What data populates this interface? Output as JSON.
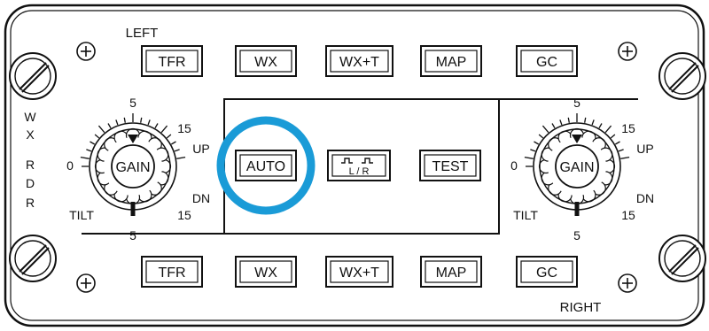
{
  "labels": {
    "left": "LEFT",
    "right": "RIGHT",
    "wx_rdr": [
      "W",
      "X",
      "R",
      "D",
      "R"
    ]
  },
  "top_row": [
    "TFR",
    "WX",
    "WX+T",
    "MAP",
    "GC"
  ],
  "bottom_row": [
    "TFR",
    "WX",
    "WX+T",
    "MAP",
    "GC"
  ],
  "center_buttons": {
    "auto": "AUTO",
    "lr": "L / R",
    "test": "TEST"
  },
  "left_knob": {
    "center": "GAIN",
    "tilt": "TILT",
    "up": "UP",
    "dn": "DN",
    "scale": {
      "top": "5",
      "upper": "15",
      "zero": "0",
      "lower": "15",
      "bottom": "5"
    }
  },
  "right_knob": {
    "center": "GAIN",
    "tilt": "TILT",
    "up": "UP",
    "dn": "DN",
    "scale": {
      "top": "5",
      "upper": "15",
      "zero": "0",
      "lower": "15",
      "bottom": "5"
    }
  },
  "colors": {
    "highlight": "#1a9bd7",
    "ink": "#111111",
    "panel": "#ffffff"
  }
}
